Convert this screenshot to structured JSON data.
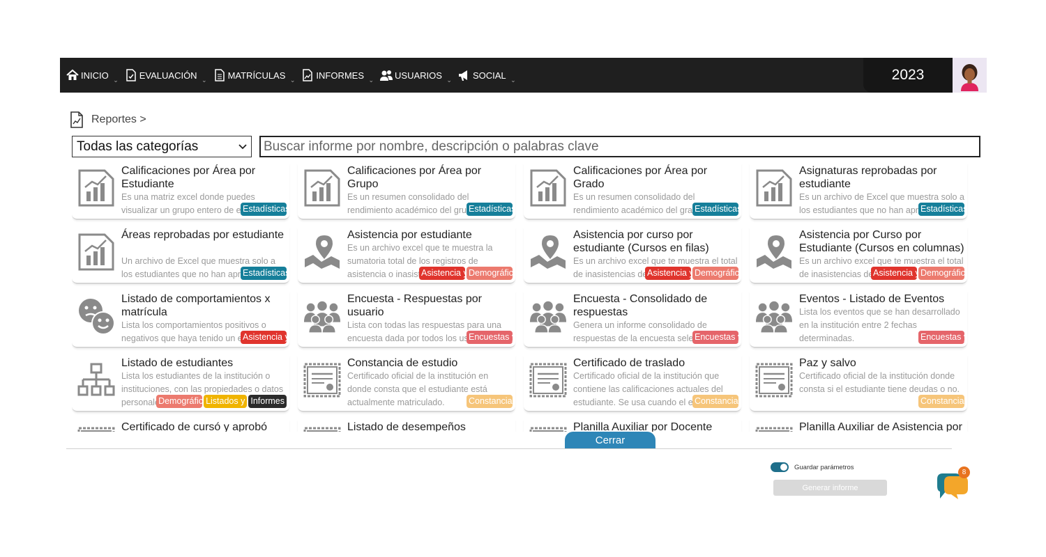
{
  "nav": {
    "items": [
      {
        "label": "INICIO",
        "icon": "home-icon"
      },
      {
        "label": "EVALUACIÓN",
        "icon": "evaluation-icon"
      },
      {
        "label": "MATRÍCULAS",
        "icon": "document-icon"
      },
      {
        "label": "INFORMES",
        "icon": "report-icon"
      },
      {
        "label": "USUARIOS",
        "icon": "users-icon"
      },
      {
        "label": "SOCIAL",
        "icon": "megaphone-icon"
      }
    ],
    "year": "2023"
  },
  "breadcrumb": {
    "label": "Reportes >"
  },
  "filters": {
    "category_selected": "Todas las categorías",
    "search_placeholder": "Buscar informe por nombre, descripción o palabras clave"
  },
  "cards": [
    {
      "title": "Calificaciones por Área por Estudiante",
      "desc": "Es una matriz excel donde puedes visualizar un grupo entero de estudiantes",
      "icon": "chart-icon",
      "tags": [
        {
          "label": "Estadísticas",
          "kind": "est"
        }
      ]
    },
    {
      "title": "Calificaciones por Área por Grupo",
      "desc": "Es un resumen consolidado del rendimiento académico del grupo en cada área",
      "icon": "chart-icon",
      "tags": [
        {
          "label": "Estadísticas",
          "kind": "est"
        }
      ]
    },
    {
      "title": "Calificaciones por Área por Grado",
      "desc": "Es un resumen consolidado del rendimiento académico del grado en cada área",
      "icon": "chart-icon",
      "tags": [
        {
          "label": "Estadísticas",
          "kind": "est"
        }
      ]
    },
    {
      "title": "Asignaturas reprobadas por estudiante",
      "desc": "Es un archivo de Excel que muestra solo a los estudiantes que no han aprobado",
      "icon": "chart-icon",
      "tags": [
        {
          "label": "Estadísticas",
          "kind": "est"
        }
      ]
    },
    {
      "title": "Áreas reprobadas por estudiante",
      "desc": "Un archivo de Excel que muestra solo a los estudiantes que no han aprobado al menos un área. Las filas serán estudiantes",
      "icon": "chart-icon",
      "tags": [
        {
          "label": "Estadísticas",
          "kind": "est"
        }
      ]
    },
    {
      "title": "Asistencia por estudiante",
      "desc": "Es un archivo excel que te muestra la sumatoria total de los registros de asistencia o inasistencia",
      "icon": "map-pin-icon",
      "tags": [
        {
          "label": "Asistencia y",
          "kind": "asis"
        },
        {
          "label": "Demográficos",
          "kind": "demo"
        }
      ]
    },
    {
      "title": "Asistencia por curso por estudiante (Cursos en filas)",
      "desc": "Es un archivo excel que te muestra el total de inasistencias de",
      "icon": "map-pin-icon",
      "tags": [
        {
          "label": "Asistencia y",
          "kind": "asis"
        },
        {
          "label": "Demográficos",
          "kind": "demo"
        }
      ]
    },
    {
      "title": "Asistencia por Curso por Estudiante (Cursos en columnas)",
      "desc": "Es un archivo excel que te muestra el total de inasistencias de",
      "icon": "map-pin-icon",
      "tags": [
        {
          "label": "Asistencia y",
          "kind": "asis"
        },
        {
          "label": "Demográficos",
          "kind": "demo"
        }
      ]
    },
    {
      "title": "Listado de comportamientos x matrícula",
      "desc": "Lista los comportamientos positivos o negativos que haya tenido un estudiante",
      "icon": "faces-icon",
      "tags": [
        {
          "label": "Asistencia y",
          "kind": "asis"
        }
      ]
    },
    {
      "title": "Encuesta - Respuestas por usuario",
      "desc": "Lista con todas las respuestas para una encuesta dada por todos los usuarios",
      "icon": "group-icon",
      "tags": [
        {
          "label": "Encuestas y",
          "kind": "enc"
        }
      ]
    },
    {
      "title": "Encuesta - Consolidado de respuestas",
      "desc": "Genera un informe consolidado de respuestas de la encuesta seleccionada",
      "icon": "group-icon",
      "tags": [
        {
          "label": "Encuestas y",
          "kind": "enc"
        }
      ]
    },
    {
      "title": "Eventos - Listado de Eventos",
      "desc": "Lista los eventos que se han desarrollado en la institución entre 2 fechas determinadas.",
      "icon": "group-icon",
      "tags": [
        {
          "label": "Encuestas y",
          "kind": "enc"
        }
      ]
    },
    {
      "title": "Listado de estudiantes",
      "desc": "Lista los estudiantes de la institución o instituciones, con las propiedades o datos personales",
      "icon": "hierarchy-icon",
      "tags": [
        {
          "label": "Demográficos",
          "kind": "demo"
        },
        {
          "label": "Listados y",
          "kind": "list"
        },
        {
          "label": "Informes",
          "kind": "inf"
        }
      ]
    },
    {
      "title": "Constancia de estudio",
      "desc": "Certificado oficial de la institución en donde consta que el estudiante está actualmente matriculado.",
      "icon": "certificate-icon",
      "tags": [
        {
          "label": "Constancias",
          "kind": "cons"
        }
      ]
    },
    {
      "title": "Certificado de traslado",
      "desc": "Certificado oficial de la institución que contiene las calificaciones actuales del estudiante. Se usa cuando el estudiante",
      "icon": "certificate-icon",
      "tags": [
        {
          "label": "Constancias",
          "kind": "cons"
        }
      ]
    },
    {
      "title": "Paz y salvo",
      "desc": "Certificado oficial de la institución donde consta si el estudiante tiene deudas o no.",
      "icon": "certificate-icon",
      "tags": [
        {
          "label": "Constancias",
          "kind": "cons"
        }
      ]
    },
    {
      "title": "Certificado de cursó y aprobó",
      "desc": "",
      "icon": "certificate-icon",
      "tags": []
    },
    {
      "title": "Listado de desempeños",
      "desc": "",
      "icon": "certificate-icon",
      "tags": []
    },
    {
      "title": "Planilla Auxiliar por Docente",
      "desc": "",
      "icon": "certificate-icon",
      "tags": []
    },
    {
      "title": "Planilla Auxiliar de Asistencia por",
      "desc": "",
      "icon": "certificate-icon",
      "tags": []
    }
  ],
  "footer": {
    "close_label": "Cerrar",
    "save_params_label": "Guardar parámetros",
    "save_params_on": true,
    "generate_label": "Generar informe",
    "chat_badge": "8"
  },
  "colors": {
    "nav_bg": "#1f1f1f",
    "accent": "#2e86b7",
    "chat": "#e8a21f"
  }
}
